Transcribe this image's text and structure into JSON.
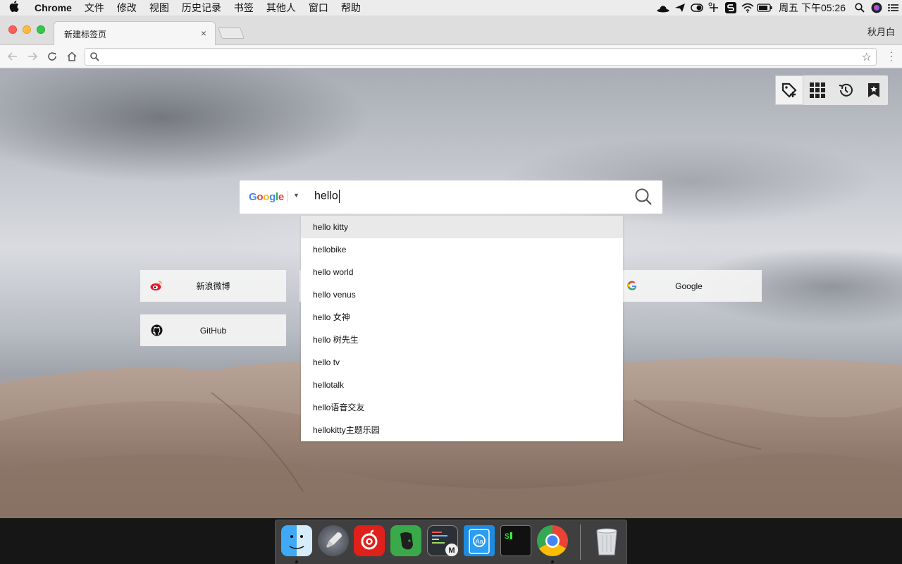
{
  "menubar": {
    "app_name": "Chrome",
    "items": [
      "文件",
      "修改",
      "视图",
      "历史记录",
      "书签",
      "其他人",
      "窗口",
      "帮助"
    ],
    "clock": "周五 下午05:26"
  },
  "tab": {
    "title": "新建标签页",
    "close": "×"
  },
  "profile_name": "秋月白",
  "omnibox": {
    "value": "",
    "placeholder": ""
  },
  "search": {
    "engine": {
      "g": "G",
      "o1": "o",
      "o2": "o",
      "g2": "g",
      "l": "l",
      "e": "e"
    },
    "query": "hello",
    "suggestions": [
      "hello kitty",
      "hellobike",
      "hello world",
      "hello venus",
      "hello 女神",
      "hello 树先生",
      "hello tv",
      "hellotalk",
      "hello语音交友",
      "hellokitty主题乐园"
    ]
  },
  "quick_links": {
    "weibo": "新浪微博",
    "github": "GitHub",
    "google": "Google"
  },
  "colors": {
    "accent_google_blue": "#4285f4",
    "google_red": "#ea4335",
    "google_yellow": "#fbbc05",
    "google_green": "#34a853",
    "weibo_red": "#e6162d"
  }
}
